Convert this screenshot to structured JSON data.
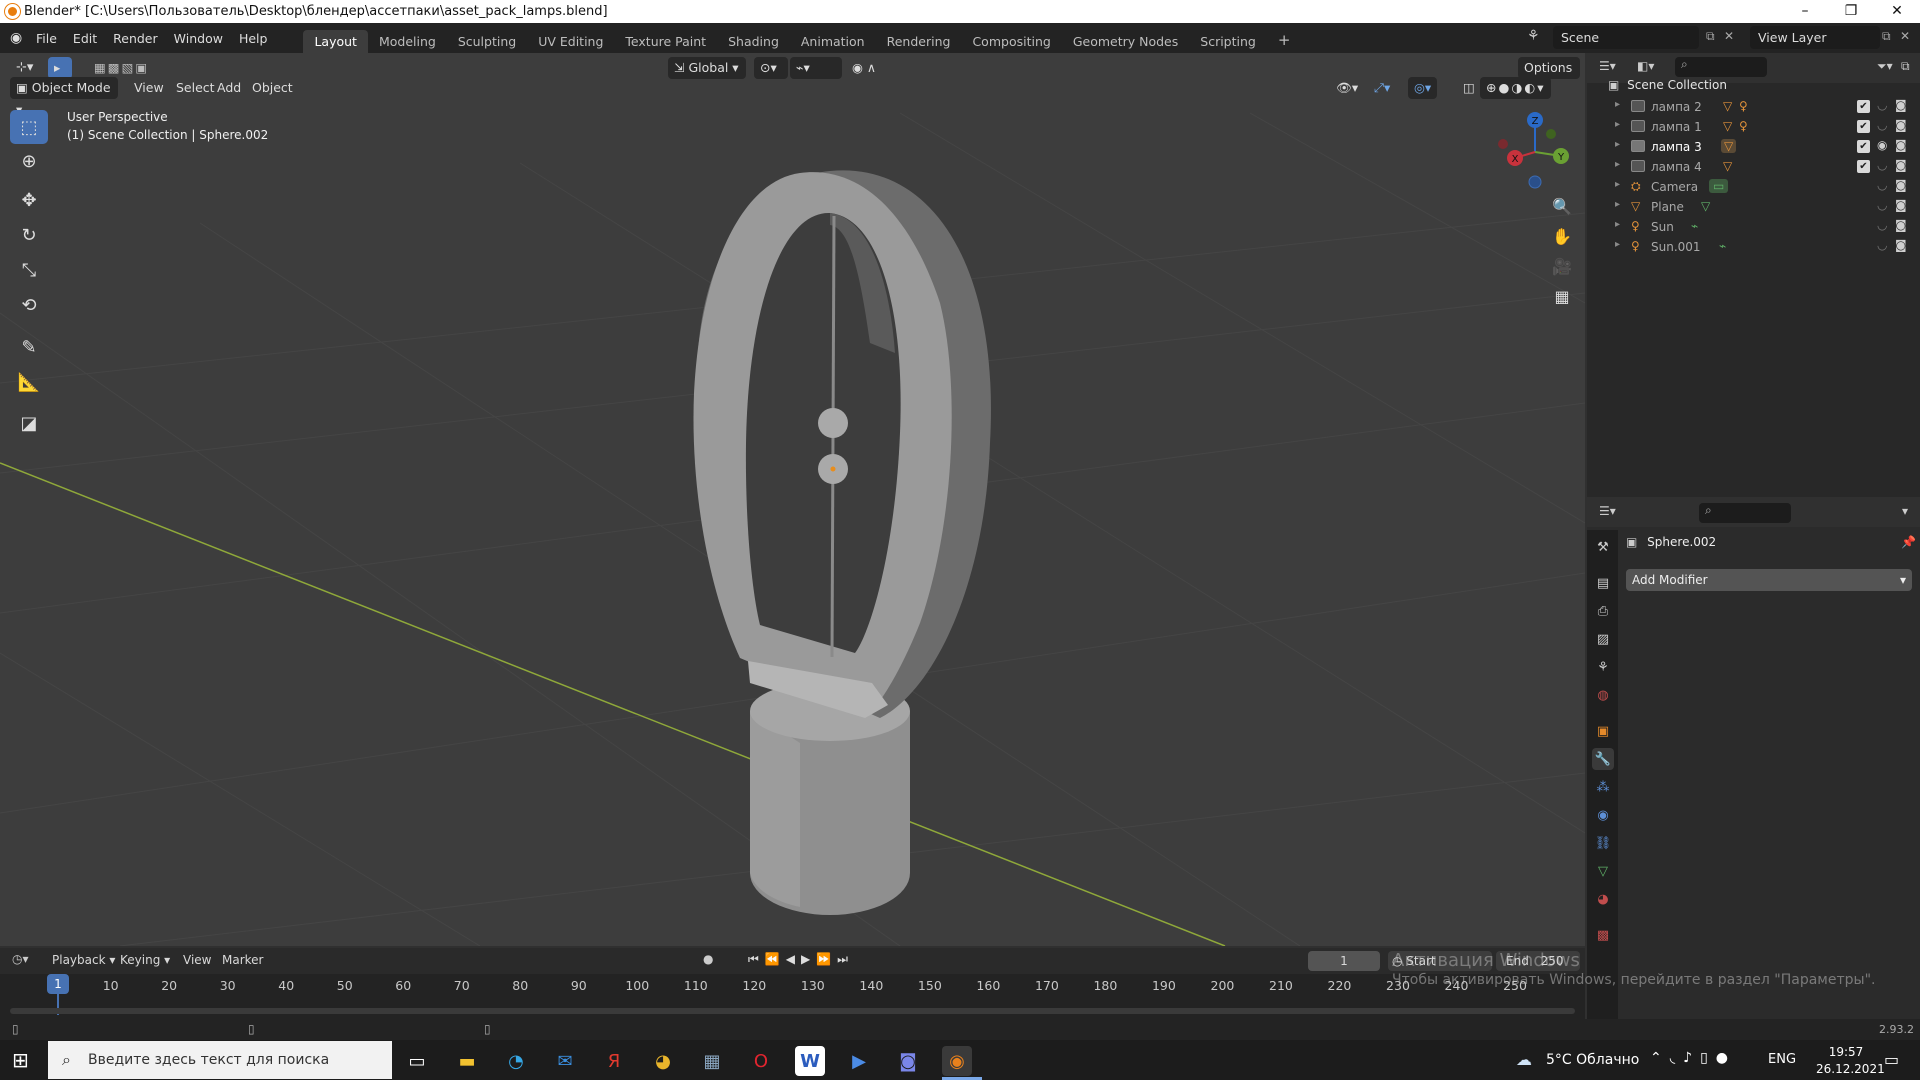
{
  "window": {
    "title": "Blender* [C:\\Users\\Пользователь\\Desktop\\блендер\\ассетпаки\\asset_pack_lamps.blend]",
    "min": "–",
    "max": "❐",
    "close": "✕"
  },
  "menu": [
    "File",
    "Edit",
    "Render",
    "Window",
    "Help"
  ],
  "workspaces": [
    "Layout",
    "Modeling",
    "Sculpting",
    "UV Editing",
    "Texture Paint",
    "Shading",
    "Animation",
    "Rendering",
    "Compositing",
    "Geometry Nodes",
    "Scripting"
  ],
  "workspace_active": "Layout",
  "scene_name": "Scene",
  "view_layer": "View Layer",
  "viewport": {
    "mode": "Object Mode",
    "menus": [
      "View",
      "Select",
      "Add",
      "Object"
    ],
    "transform_orientation": "Global",
    "options": "Options",
    "overlay_line1": "User Perspective",
    "overlay_line2": "(1) Scene Collection | Sphere.002",
    "gizmo": {
      "x": "X",
      "y": "Y",
      "z": "Z"
    }
  },
  "outliner": {
    "root": "Scene Collection",
    "items": [
      {
        "name": "лампа 2",
        "type": "collection",
        "checked": true,
        "visible": false
      },
      {
        "name": "лампа 1",
        "type": "collection",
        "checked": true,
        "visible": false
      },
      {
        "name": "лампа 3",
        "type": "collection",
        "checked": true,
        "visible": true
      },
      {
        "name": "лампа 4",
        "type": "collection",
        "checked": true,
        "visible": false
      },
      {
        "name": "Camera",
        "type": "camera"
      },
      {
        "name": "Plane",
        "type": "mesh"
      },
      {
        "name": "Sun",
        "type": "light"
      },
      {
        "name": "Sun.001",
        "type": "light"
      }
    ]
  },
  "properties": {
    "object_name": "Sphere.002",
    "add_modifier": "Add Modifier"
  },
  "timeline": {
    "menus": [
      "Playback",
      "Keying",
      "View",
      "Marker"
    ],
    "current_frame": "1",
    "start_label": "Start",
    "start_value": "1",
    "end_label": "End",
    "end_value": "250",
    "ticks": [
      "1",
      "10",
      "20",
      "30",
      "40",
      "50",
      "60",
      "70",
      "80",
      "90",
      "100",
      "110",
      "120",
      "130",
      "140",
      "150",
      "160",
      "170",
      "180",
      "190",
      "200",
      "210",
      "220",
      "230",
      "240",
      "250"
    ]
  },
  "activation": {
    "line1": "Активация Windows",
    "line2": "Чтобы активировать Windows, перейдите в раздел \"Параметры\"."
  },
  "version": "2.93.2",
  "taskbar": {
    "search_placeholder": "Введите здесь текст для поиска",
    "weather": "5°C Облачно",
    "lang": "ENG",
    "time": "19:57",
    "date": "26.12.2021"
  }
}
